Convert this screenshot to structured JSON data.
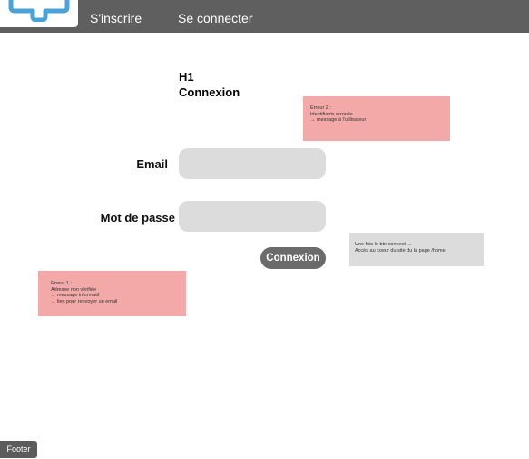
{
  "navbar": {
    "logo": "logo-icon",
    "links": {
      "signup": "S'inscrire",
      "login": "Se connecter"
    }
  },
  "main": {
    "heading_tag": "H1",
    "title": "Connexion",
    "form": {
      "email_label": "Email",
      "email_value": "",
      "password_label": "Mot de passe",
      "password_value": "",
      "submit_label": "Connexion"
    }
  },
  "notes": {
    "error2": {
      "title": "Erreur 2 :",
      "line1": "Identifiants  erronés",
      "line2": "→ message à l'utilisateur"
    },
    "error1": {
      "title": "Erreur 1 :",
      "line1": "Adresse non vérifiée",
      "line2": "→ message informatif",
      "line3": "→ lien pour renvoyer un email"
    },
    "success": {
      "line1": "Une fois le btn connect →",
      "line2": "Accès au coeur du site du la page /home"
    }
  },
  "footer": {
    "label": "Footer"
  },
  "colors": {
    "navbar_bg": "#5f5f5f",
    "error_note_bg": "#f4a9a9",
    "info_note_bg": "#dcdcdc",
    "input_bg": "#dcdcdc",
    "button_bg": "#6b6b6b",
    "logo_stroke": "#4aa3d8"
  }
}
